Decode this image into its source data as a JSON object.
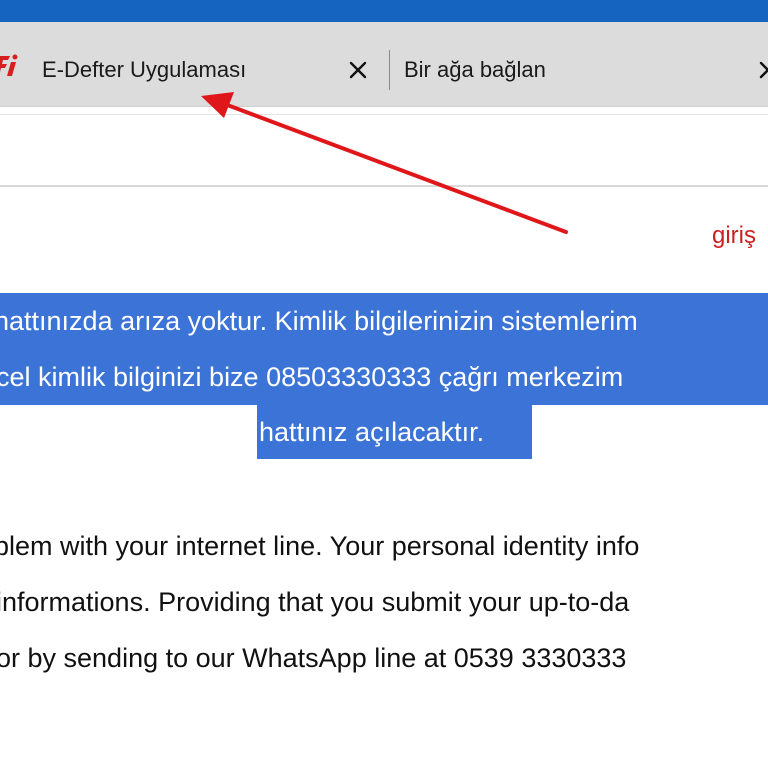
{
  "browser": {
    "tabs": [
      {
        "title": "E-Defter Uygulaması",
        "close_glyph": "✕"
      },
      {
        "title": "Bir ağa bağlan",
        "close_glyph": "✕"
      }
    ],
    "favicon": "red-brand-favicon",
    "title_bar_color": "#1565c0",
    "tab_bar_color": "#dcdcdc"
  },
  "annotation": {
    "label": "giriş",
    "color": "#cc1f1f",
    "icon": "red-arrow-annotation"
  },
  "message": {
    "turkish_lines": [
      "hattınızda arıza yoktur. Kimlik bilgilerinizin sistemlerim",
      "cel kimlik bilginizi bize 08503330333 çağrı merkezim",
      "hattınız açılacaktır."
    ],
    "english_lines": [
      "blem with your internet line. Your personal identity info",
      "informations. Providing that you submit your up-to-da",
      "or by sending to our WhatsApp line at 0539 3330333"
    ],
    "highlight_color": "#3b73d6"
  }
}
